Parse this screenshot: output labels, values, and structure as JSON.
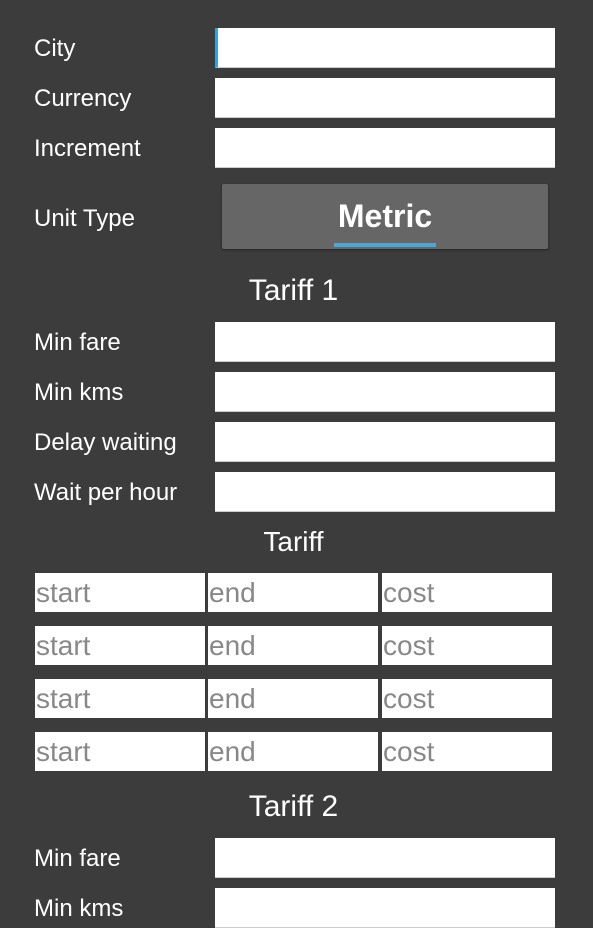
{
  "general": {
    "city_label": "City",
    "currency_label": "Currency",
    "increment_label": "Increment",
    "city_value": "",
    "currency_value": "",
    "increment_value": "",
    "unit_type_label": "Unit Type",
    "unit_type_value": "Metric"
  },
  "tariff1": {
    "heading": "Tariff 1",
    "min_fare_label": "Min fare",
    "min_kms_label": "Min kms",
    "delay_waiting_label": "Delay waiting",
    "wait_per_hour_label": "Wait per hour",
    "min_fare_value": "",
    "min_kms_value": "",
    "delay_waiting_value": "",
    "wait_per_hour_value": ""
  },
  "tariff_table": {
    "heading": "Tariff",
    "placeholders": {
      "start": "start",
      "end": "end",
      "cost": "cost"
    },
    "rows": [
      {
        "start": "",
        "end": "",
        "cost": ""
      },
      {
        "start": "",
        "end": "",
        "cost": ""
      },
      {
        "start": "",
        "end": "",
        "cost": ""
      },
      {
        "start": "",
        "end": "",
        "cost": ""
      }
    ]
  },
  "tariff2": {
    "heading": "Tariff 2",
    "min_fare_label": "Min fare",
    "min_kms_label": "Min kms",
    "min_fare_value": "",
    "min_kms_value": ""
  },
  "colors": {
    "background": "#3c3c3c",
    "accent": "#4aa8d8",
    "button": "#666666"
  }
}
